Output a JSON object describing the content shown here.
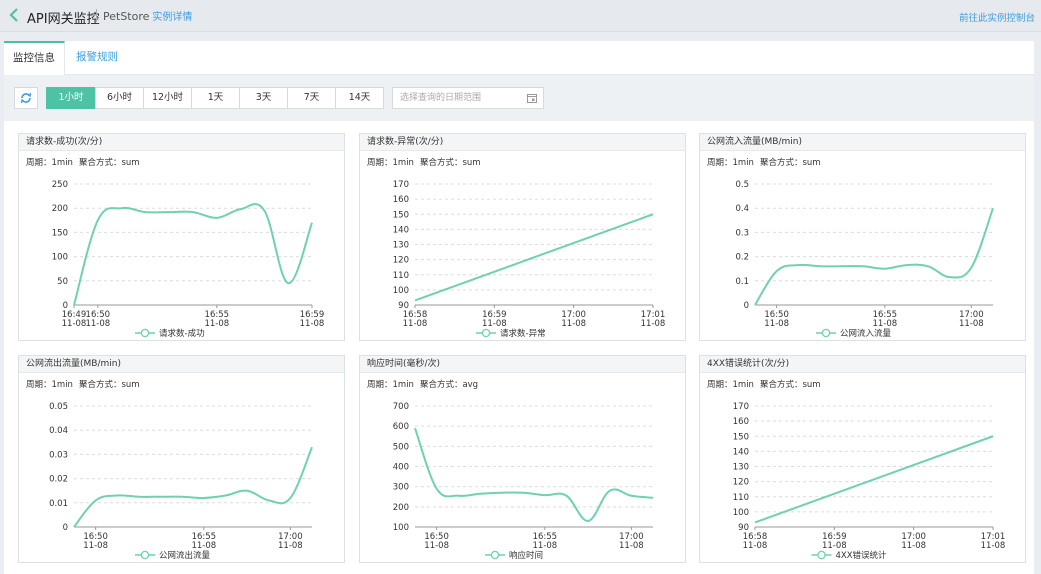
{
  "header": {
    "title": "API网关监控",
    "subtitle": "PetStore",
    "detail_link": "实例详情",
    "goto_console": "前往此实例控制台"
  },
  "tabs": [
    {
      "label": "监控信息",
      "active": true
    },
    {
      "label": "报警规则",
      "active": false
    }
  ],
  "toolbar": {
    "ranges": [
      {
        "label": "1小时",
        "active": true
      },
      {
        "label": "6小时",
        "active": false
      },
      {
        "label": "12小时",
        "active": false
      },
      {
        "label": "1天",
        "active": false
      },
      {
        "label": "3天",
        "active": false
      },
      {
        "label": "7天",
        "active": false
      },
      {
        "label": "14天",
        "active": false
      }
    ],
    "date_placeholder": "选择查询的日期范围"
  },
  "colors": {
    "accent": "#4ec3a4",
    "line": "#6fd1b1",
    "link": "#3c9ee0"
  },
  "chart_data": [
    {
      "type": "line",
      "title": "请求数-成功(次/分)",
      "period": "周期：1min",
      "agg": "聚合方式：sum",
      "series_name": "请求数-成功",
      "ylim": [
        0,
        250
      ],
      "yticks": [
        0,
        50,
        100,
        150,
        200,
        250
      ],
      "xlim": [
        0,
        10
      ],
      "xticks": [
        {
          "x": 0,
          "l1": "16:49",
          "l2": "11-08"
        },
        {
          "x": 1,
          "l1": "16:50",
          "l2": "11-08"
        },
        {
          "x": 6,
          "l1": "16:55",
          "l2": "11-08"
        },
        {
          "x": 10,
          "l1": "16:59",
          "l2": "11-08"
        }
      ],
      "x": [
        0,
        1,
        2,
        3,
        4,
        5,
        6,
        7,
        8,
        9,
        10
      ],
      "y": [
        0,
        175,
        200,
        192,
        192,
        192,
        180,
        198,
        195,
        45,
        170
      ]
    },
    {
      "type": "line",
      "title": "请求数-异常(次/分)",
      "period": "周期：1min",
      "agg": "聚合方式：sum",
      "series_name": "请求数-异常",
      "ylim": [
        90,
        170
      ],
      "yticks": [
        90,
        100,
        110,
        120,
        130,
        140,
        150,
        160,
        170
      ],
      "xlim": [
        0,
        3
      ],
      "xticks": [
        {
          "x": 0,
          "l1": "16:58",
          "l2": "11-08"
        },
        {
          "x": 1,
          "l1": "16:59",
          "l2": "11-08"
        },
        {
          "x": 2,
          "l1": "17:00",
          "l2": "11-08"
        },
        {
          "x": 3,
          "l1": "17:01",
          "l2": "11-08"
        }
      ],
      "x": [
        0,
        3
      ],
      "y": [
        93,
        150
      ]
    },
    {
      "type": "line",
      "title": "公网流入流量(MB/min)",
      "period": "周期：1min",
      "agg": "聚合方式：sum",
      "series_name": "公网流入流量",
      "ylim": [
        0,
        0.5
      ],
      "yticks": [
        0,
        0.1,
        0.2,
        0.3,
        0.4,
        0.5
      ],
      "xlim": [
        0,
        11
      ],
      "xticks": [
        {
          "x": 1,
          "l1": "16:50",
          "l2": "11-08"
        },
        {
          "x": 6,
          "l1": "16:55",
          "l2": "11-08"
        },
        {
          "x": 10,
          "l1": "17:00",
          "l2": "11-08"
        }
      ],
      "x": [
        0,
        1,
        2,
        3,
        4,
        5,
        6,
        7,
        8,
        9,
        10,
        11
      ],
      "y": [
        0,
        0.14,
        0.165,
        0.16,
        0.16,
        0.16,
        0.15,
        0.165,
        0.16,
        0.115,
        0.155,
        0.4
      ]
    },
    {
      "type": "line",
      "title": "公网流出流量(MB/min)",
      "period": "周期：1min",
      "agg": "聚合方式：sum",
      "series_name": "公网流出流量",
      "ylim": [
        0,
        0.05
      ],
      "yticks": [
        0,
        0.01,
        0.02,
        0.03,
        0.04,
        0.05
      ],
      "xlim": [
        0,
        11
      ],
      "xticks": [
        {
          "x": 1,
          "l1": "16:50",
          "l2": "11-08"
        },
        {
          "x": 6,
          "l1": "16:55",
          "l2": "11-08"
        },
        {
          "x": 10,
          "l1": "17:00",
          "l2": "11-08"
        }
      ],
      "x": [
        0,
        1,
        2,
        3,
        4,
        5,
        6,
        7,
        8,
        9,
        10,
        11
      ],
      "y": [
        0,
        0.011,
        0.013,
        0.0125,
        0.0125,
        0.0125,
        0.012,
        0.013,
        0.015,
        0.011,
        0.012,
        0.033
      ]
    },
    {
      "type": "line",
      "title": "响应时间(毫秒/次)",
      "period": "周期：1min",
      "agg": "聚合方式：avg",
      "series_name": "响应时间",
      "ylim": [
        100,
        700
      ],
      "yticks": [
        100,
        200,
        300,
        400,
        500,
        600,
        700
      ],
      "xlim": [
        0,
        11
      ],
      "xticks": [
        {
          "x": 1,
          "l1": "16:50",
          "l2": "11-08"
        },
        {
          "x": 6,
          "l1": "16:55",
          "l2": "11-08"
        },
        {
          "x": 10,
          "l1": "17:00",
          "l2": "11-08"
        }
      ],
      "x": [
        0,
        1,
        2,
        3,
        4,
        5,
        6,
        7,
        8,
        9,
        10,
        11
      ],
      "y": [
        590,
        290,
        255,
        265,
        270,
        270,
        258,
        255,
        130,
        280,
        255,
        245
      ]
    },
    {
      "type": "line",
      "title": "4XX错误统计(次/分)",
      "period": "周期：1min",
      "agg": "聚合方式：sum",
      "series_name": "4XX错误统计",
      "ylim": [
        90,
        170
      ],
      "yticks": [
        90,
        100,
        110,
        120,
        130,
        140,
        150,
        160,
        170
      ],
      "xlim": [
        0,
        3
      ],
      "xticks": [
        {
          "x": 0,
          "l1": "16:58",
          "l2": "11-08"
        },
        {
          "x": 1,
          "l1": "16:59",
          "l2": "11-08"
        },
        {
          "x": 2,
          "l1": "17:00",
          "l2": "11-08"
        },
        {
          "x": 3,
          "l1": "17:01",
          "l2": "11-08"
        }
      ],
      "x": [
        0,
        3
      ],
      "y": [
        93,
        150
      ]
    }
  ]
}
